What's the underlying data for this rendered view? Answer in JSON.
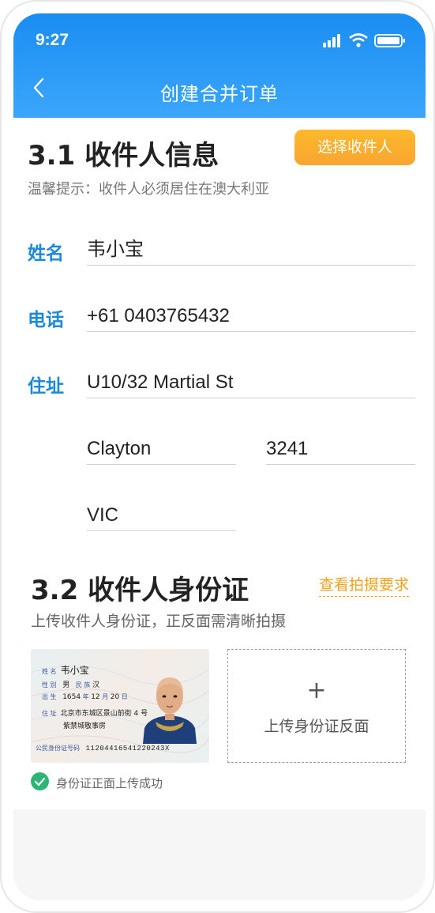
{
  "status_bar": {
    "time": "9:27"
  },
  "nav": {
    "title": "创建合并订单"
  },
  "recipient": {
    "section_title": "3.1 收件人信息",
    "select_button": "选择收件人",
    "hint": "温馨提示：收件人必须居住在澳大利亚",
    "name_label": "姓名",
    "name_value": "韦小宝",
    "phone_label": "电话",
    "phone_value": "+61  0403765432",
    "address_label": "住址",
    "address_line": "U10/32 Martial St",
    "suburb": "Clayton",
    "postcode": "3241",
    "state": "VIC"
  },
  "id_section": {
    "section_title": "3.2  收件人身份证",
    "requirements_link": "查看拍摄要求",
    "hint": "上传收件人身份证，正反面需清晰拍摄",
    "back_upload_label": "上传身份证反面",
    "upload_plus": "+",
    "success_text": "身份证正面上传成功",
    "card": {
      "name_label": "姓 名",
      "name": "韦小宝",
      "gender_label": "性 别",
      "gender": "男",
      "ethnicity_label": "民 族",
      "ethnicity": "汉",
      "birth_label": "出 生",
      "birth_year": "1654",
      "year_unit": "年",
      "birth_month": "12",
      "month_unit": "月",
      "birth_day": "20",
      "day_unit": "日",
      "address_label": "住 址",
      "address_line1": "北京市东城区景山前街 4 号",
      "address_line2": "紫禁城敬事房",
      "id_label": "公民身份证号码",
      "id_number": "11204416541220243X"
    }
  },
  "colors": {
    "header_blue": "#1a8df2",
    "label_blue": "#1a88dc",
    "accent_orange": "#f9a531",
    "success_green": "#2bb673"
  }
}
